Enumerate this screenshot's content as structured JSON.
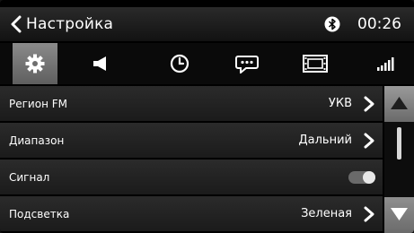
{
  "header": {
    "title": "Настройка",
    "time": "00:26",
    "bluetooth_icon": "bluetooth-icon",
    "back_icon": "chevron-left-icon"
  },
  "tabs": [
    {
      "icon": "gear-icon",
      "active": true
    },
    {
      "icon": "speaker-icon",
      "active": false
    },
    {
      "icon": "clock-icon",
      "active": false
    },
    {
      "icon": "chat-bubble-icon",
      "active": false
    },
    {
      "icon": "film-icon",
      "active": false
    },
    {
      "icon": "signal-bars-icon",
      "active": false
    }
  ],
  "rows": [
    {
      "label": "Регион FM",
      "value": "УКВ"
    },
    {
      "label": "Диапазон",
      "value": "Дальний"
    },
    {
      "label": "Сигнал",
      "value": ""
    },
    {
      "label": "Подсветка",
      "value": "Зеленая"
    }
  ],
  "signal_toggle_on": true,
  "colors": {
    "accent_tab": "#7a7a7a",
    "row_bg": "#242424",
    "text": "#ffffff"
  }
}
